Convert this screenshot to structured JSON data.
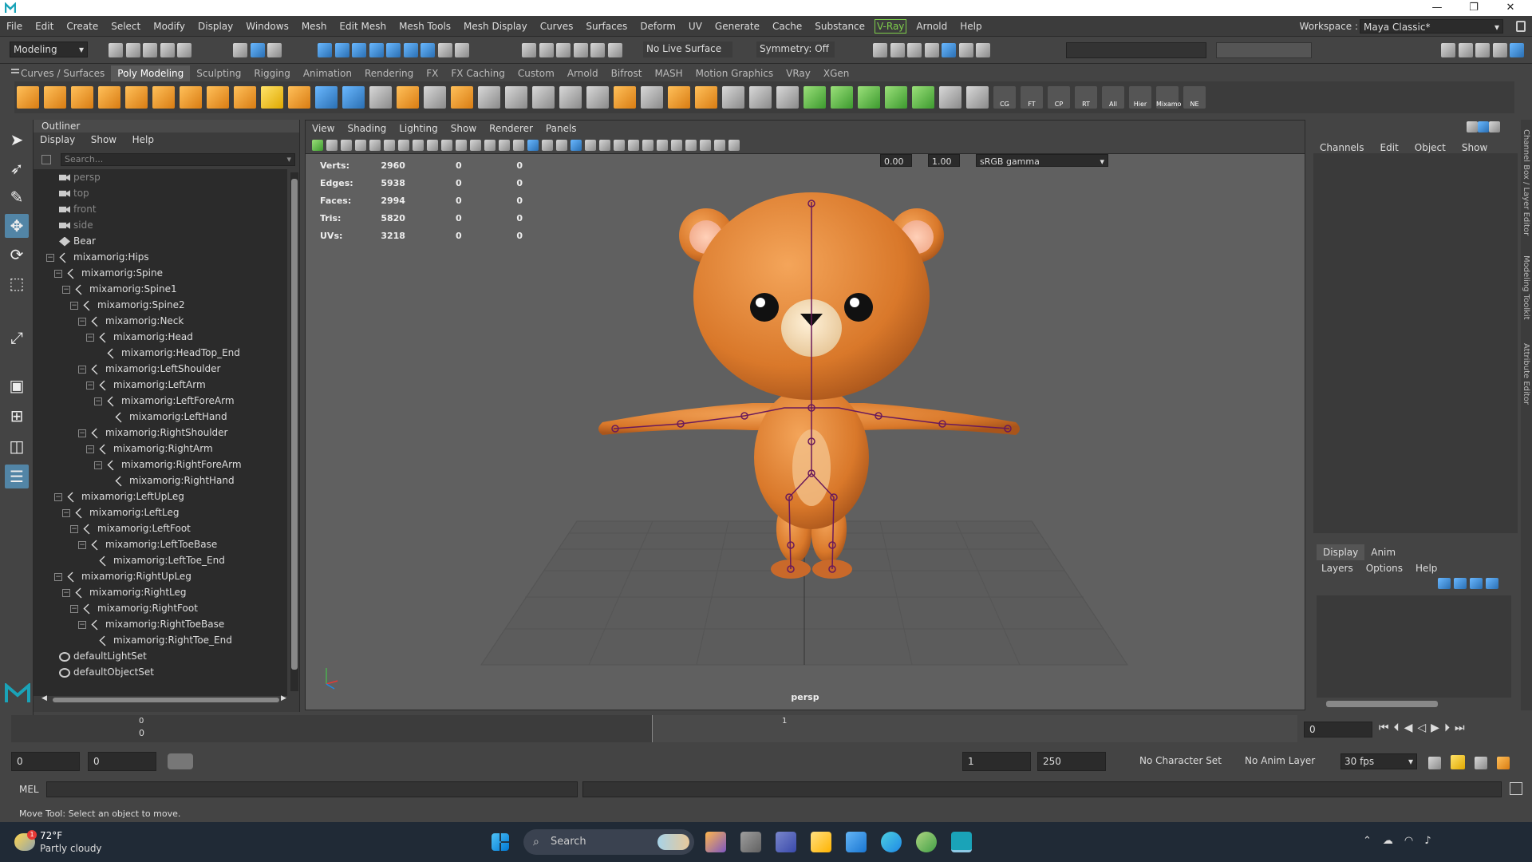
{
  "window": {
    "minimize": "—",
    "maximize": "❐",
    "close": "✕"
  },
  "menubar": {
    "items": [
      "File",
      "Edit",
      "Create",
      "Select",
      "Modify",
      "Display",
      "Windows",
      "Mesh",
      "Edit Mesh",
      "Mesh Tools",
      "Mesh Display",
      "Curves",
      "Surfaces",
      "Deform",
      "UV",
      "Generate",
      "Cache",
      "Substance",
      "V-Ray",
      "Arnold",
      "Help"
    ],
    "workspace_label": "Workspace :",
    "workspace_value": "Maya Classic*"
  },
  "statusline": {
    "menuset": "Modeling",
    "live_surface": "No Live Surface",
    "symmetry": "Symmetry: Off"
  },
  "shelf": {
    "tabs": [
      "Curves / Surfaces",
      "Poly Modeling",
      "Sculpting",
      "Rigging",
      "Animation",
      "Rendering",
      "FX",
      "FX Caching",
      "Custom",
      "Arnold",
      "Bifrost",
      "MASH",
      "Motion Graphics",
      "VRay",
      "XGen"
    ],
    "active_tab": "Poly Modeling",
    "labeled_icons": [
      "CG",
      "FT",
      "CP",
      "RT",
      "All",
      "Hier",
      "Mixamo",
      "NE"
    ]
  },
  "outliner": {
    "title": "Outliner",
    "menu": [
      "Display",
      "Show",
      "Help"
    ],
    "search_placeholder": "Search...",
    "rows": [
      {
        "label": "persp",
        "depth": 0,
        "icon": "camera",
        "dim": true,
        "expander": ""
      },
      {
        "label": "top",
        "depth": 0,
        "icon": "camera",
        "dim": true,
        "expander": ""
      },
      {
        "label": "front",
        "depth": 0,
        "icon": "camera",
        "dim": true,
        "expander": ""
      },
      {
        "label": "side",
        "depth": 0,
        "icon": "camera",
        "dim": true,
        "expander": ""
      },
      {
        "label": "Bear",
        "depth": 0,
        "icon": "mesh",
        "dim": false,
        "expander": ""
      },
      {
        "label": "mixamorig:Hips",
        "depth": 0,
        "icon": "joint",
        "dim": false,
        "expander": "−"
      },
      {
        "label": "mixamorig:Spine",
        "depth": 1,
        "icon": "joint",
        "dim": false,
        "expander": "−"
      },
      {
        "label": "mixamorig:Spine1",
        "depth": 2,
        "icon": "joint",
        "dim": false,
        "expander": "−"
      },
      {
        "label": "mixamorig:Spine2",
        "depth": 3,
        "icon": "joint",
        "dim": false,
        "expander": "−"
      },
      {
        "label": "mixamorig:Neck",
        "depth": 4,
        "icon": "joint",
        "dim": false,
        "expander": "−"
      },
      {
        "label": "mixamorig:Head",
        "depth": 5,
        "icon": "joint",
        "dim": false,
        "expander": "−"
      },
      {
        "label": "mixamorig:HeadTop_End",
        "depth": 6,
        "icon": "joint",
        "dim": false,
        "expander": ""
      },
      {
        "label": "mixamorig:LeftShoulder",
        "depth": 4,
        "icon": "joint",
        "dim": false,
        "expander": "−"
      },
      {
        "label": "mixamorig:LeftArm",
        "depth": 5,
        "icon": "joint",
        "dim": false,
        "expander": "−"
      },
      {
        "label": "mixamorig:LeftForeArm",
        "depth": 6,
        "icon": "joint",
        "dim": false,
        "expander": "−"
      },
      {
        "label": "mixamorig:LeftHand",
        "depth": 7,
        "icon": "joint",
        "dim": false,
        "expander": ""
      },
      {
        "label": "mixamorig:RightShoulder",
        "depth": 4,
        "icon": "joint",
        "dim": false,
        "expander": "−"
      },
      {
        "label": "mixamorig:RightArm",
        "depth": 5,
        "icon": "joint",
        "dim": false,
        "expander": "−"
      },
      {
        "label": "mixamorig:RightForeArm",
        "depth": 6,
        "icon": "joint",
        "dim": false,
        "expander": "−"
      },
      {
        "label": "mixamorig:RightHand",
        "depth": 7,
        "icon": "joint",
        "dim": false,
        "expander": ""
      },
      {
        "label": "mixamorig:LeftUpLeg",
        "depth": 1,
        "icon": "joint",
        "dim": false,
        "expander": "−"
      },
      {
        "label": "mixamorig:LeftLeg",
        "depth": 2,
        "icon": "joint",
        "dim": false,
        "expander": "−"
      },
      {
        "label": "mixamorig:LeftFoot",
        "depth": 3,
        "icon": "joint",
        "dim": false,
        "expander": "−"
      },
      {
        "label": "mixamorig:LeftToeBase",
        "depth": 4,
        "icon": "joint",
        "dim": false,
        "expander": "−"
      },
      {
        "label": "mixamorig:LeftToe_End",
        "depth": 5,
        "icon": "joint",
        "dim": false,
        "expander": ""
      },
      {
        "label": "mixamorig:RightUpLeg",
        "depth": 1,
        "icon": "joint",
        "dim": false,
        "expander": "−"
      },
      {
        "label": "mixamorig:RightLeg",
        "depth": 2,
        "icon": "joint",
        "dim": false,
        "expander": "−"
      },
      {
        "label": "mixamorig:RightFoot",
        "depth": 3,
        "icon": "joint",
        "dim": false,
        "expander": "−"
      },
      {
        "label": "mixamorig:RightToeBase",
        "depth": 4,
        "icon": "joint",
        "dim": false,
        "expander": "−"
      },
      {
        "label": "mixamorig:RightToe_End",
        "depth": 5,
        "icon": "joint",
        "dim": false,
        "expander": ""
      },
      {
        "label": "defaultLightSet",
        "depth": 0,
        "icon": "set",
        "dim": false,
        "expander": ""
      },
      {
        "label": "defaultObjectSet",
        "depth": 0,
        "icon": "set",
        "dim": false,
        "expander": ""
      }
    ]
  },
  "viewport": {
    "menu": [
      "View",
      "Shading",
      "Lighting",
      "Show",
      "Renderer",
      "Panels"
    ],
    "exposure": "0.00",
    "gamma": "1.00",
    "colorspace": "sRGB gamma",
    "camera": "persp",
    "hud": [
      {
        "label": "Verts:",
        "v1": "2960",
        "v2": "0",
        "v3": "0"
      },
      {
        "label": "Edges:",
        "v1": "5938",
        "v2": "0",
        "v3": "0"
      },
      {
        "label": "Faces:",
        "v1": "2994",
        "v2": "0",
        "v3": "0"
      },
      {
        "label": "Tris:",
        "v1": "5820",
        "v2": "0",
        "v3": "0"
      },
      {
        "label": "UVs:",
        "v1": "3218",
        "v2": "0",
        "v3": "0"
      }
    ]
  },
  "channelbox": {
    "menu": [
      "Channels",
      "Edit",
      "Object",
      "Show"
    ]
  },
  "layer_editor": {
    "tabs": [
      "Display",
      "Anim"
    ],
    "active_tab": "Display",
    "menu": [
      "Layers",
      "Options",
      "Help"
    ]
  },
  "sidestrip": {
    "labels": [
      "Channel Box / Layer Editor",
      "Modeling Toolkit",
      "Attribute Editor"
    ]
  },
  "timeslider": {
    "tick_0": "0",
    "tick_1": "1",
    "current_frame": "0",
    "frame_field": "0"
  },
  "rangebar": {
    "start": "0",
    "playback_start": "0",
    "playback_end": "1",
    "end": "250",
    "character_set": "No Character Set",
    "anim_layer": "No Anim Layer",
    "fps": "30 fps"
  },
  "cmdline": {
    "label": "MEL"
  },
  "status_message": "Move Tool: Select an object to move.",
  "taskbar": {
    "weather_temp": "72°F",
    "weather_desc": "Partly cloudy",
    "weather_badge": "1",
    "search_placeholder": "Search"
  }
}
